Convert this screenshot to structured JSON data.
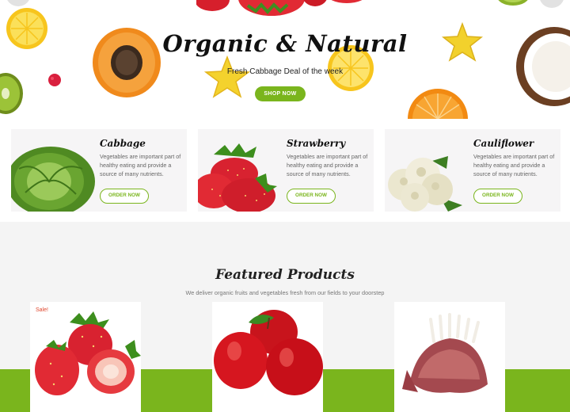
{
  "hero": {
    "title": "Organic & Natural",
    "subtitle": "Fresh Cabbage Deal of the week",
    "button": "SHOP NOW"
  },
  "categories": [
    {
      "name": "Cabbage",
      "description": "Vegetables are important part of healthy eating and provide a source of many nutrients.",
      "button": "ORDER NOW",
      "image": "cabbage-image"
    },
    {
      "name": "Strawberry",
      "description": "Vegetables are important part of healthy eating and provide a source of many nutrients.",
      "button": "ORDER NOW",
      "image": "strawberry-image"
    },
    {
      "name": "Cauliflower",
      "description": "Vegetables are important part of healthy eating and provide a source of many nutrients.",
      "button": "ORDER NOW",
      "image": "cauliflower-image"
    }
  ],
  "featured": {
    "title": "Featured Products",
    "subtitle": "We deliver organic fruits and vegetables fresh from our fields to your doorstep",
    "products": [
      {
        "image": "strawberries-image",
        "badge": "Sale!"
      },
      {
        "image": "red-apples-image",
        "badge": ""
      },
      {
        "image": "lamb-rack-image",
        "badge": ""
      }
    ]
  },
  "colors": {
    "accent": "#7ab51d",
    "sale": "#e0452b",
    "card_background": "#f6f5f6",
    "section_background": "#f4f4f4"
  }
}
